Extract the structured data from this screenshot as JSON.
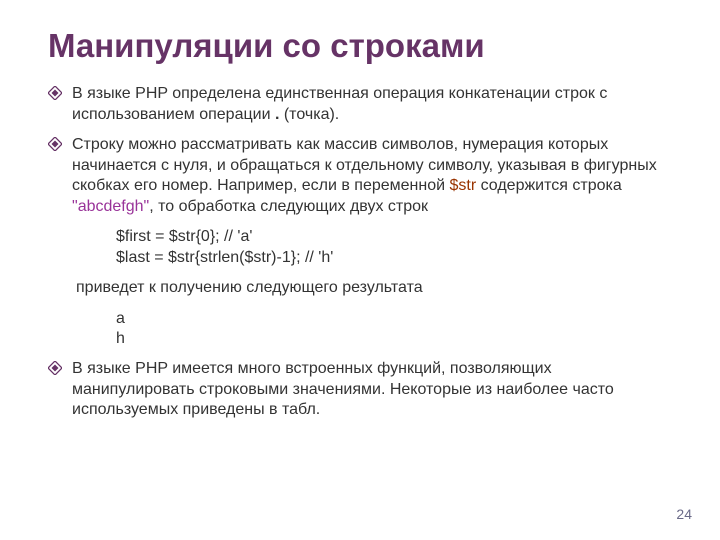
{
  "title": "Манипуляции со строками",
  "bullets": {
    "b1": {
      "pre": "В языке PHP определена единственная операция конкатенации строк с использованием операции ",
      "dot": ".",
      "post": " (точка)."
    },
    "b2": {
      "p1": "Строку можно рассматривать как массив символов, нумерация которых начинается с нуля, и обращаться к отдельному символу, указывая в фигурных скобках его номер. Например, если в переменной ",
      "var": "$str",
      "p2": " содержится строка ",
      "qopen": "\"",
      "strv": "abcdefgh",
      "qclose": "\"",
      "p3": ", то обработка следующих двух строк"
    },
    "b3": "В языке PHP имеется много встроенных функций, позволяющих манипулировать строковыми значениями. Некоторые из наиболее часто используемых приведены в табл."
  },
  "code": {
    "l1": "$first = $str{0}; // 'a'",
    "l2": "$last = $str{strlen($str)-1}; // 'h'"
  },
  "aftercode": "приведет к получению следующего результата",
  "result": {
    "r1": "a",
    "r2": "h"
  },
  "pagenum": "24"
}
